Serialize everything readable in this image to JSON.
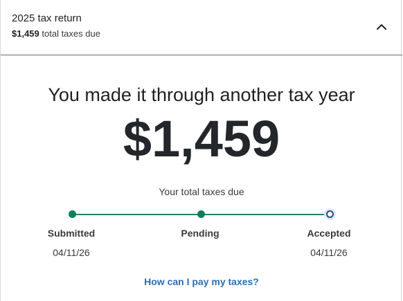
{
  "header": {
    "title": "2025 tax return",
    "amount": "$1,459",
    "amount_suffix": "total taxes due",
    "toggle_icon": "chevron-up-icon"
  },
  "main": {
    "headline": "You made it through another tax year",
    "amount": "$1,459",
    "amount_label": "Your total taxes due"
  },
  "progress": {
    "steps": [
      {
        "label": "Submitted",
        "date": "04/11/26",
        "state": "complete"
      },
      {
        "label": "Pending",
        "date": "",
        "state": "complete"
      },
      {
        "label": "Accepted",
        "date": "04/11/26",
        "state": "current"
      }
    ],
    "colors": {
      "complete": "#0e7e5c",
      "current_ring": "#2b4c7e"
    }
  },
  "links": {
    "pay": "How can I pay my taxes?"
  }
}
